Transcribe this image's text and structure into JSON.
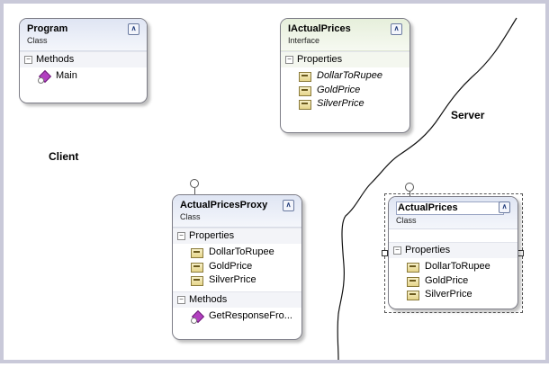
{
  "labels": {
    "client": "Client",
    "server": "Server"
  },
  "shapes": {
    "program": {
      "name": "Program",
      "kind": "Class",
      "sections": [
        {
          "title": "Methods",
          "members": [
            {
              "name": "Main",
              "icon": "method-icon"
            }
          ]
        }
      ]
    },
    "iactualprices": {
      "name": "IActualPrices",
      "kind": "Interface",
      "sections": [
        {
          "title": "Properties",
          "members": [
            {
              "name": "DollarToRupee",
              "icon": "property-icon"
            },
            {
              "name": "GoldPrice",
              "icon": "property-icon"
            },
            {
              "name": "SilverPrice",
              "icon": "property-icon"
            }
          ]
        }
      ]
    },
    "proxy": {
      "name": "ActualPricesProxy",
      "kind": "Class",
      "sections": [
        {
          "title": "Properties",
          "members": [
            {
              "name": "DollarToRupee",
              "icon": "property-icon"
            },
            {
              "name": "GoldPrice",
              "icon": "property-icon"
            },
            {
              "name": "SilverPrice",
              "icon": "property-icon"
            }
          ]
        },
        {
          "title": "Methods",
          "members": [
            {
              "name": "GetResponseFro...",
              "icon": "method-icon"
            }
          ]
        }
      ]
    },
    "actualprices": {
      "name": "ActualPrices",
      "kind": "Class",
      "sections": [
        {
          "title": "Properties",
          "members": [
            {
              "name": "DollarToRupee",
              "icon": "property-icon"
            },
            {
              "name": "GoldPrice",
              "icon": "property-icon"
            },
            {
              "name": "SilverPrice",
              "icon": "property-icon"
            }
          ]
        }
      ]
    }
  },
  "colors": {
    "canvas_border": "#c9c9d9",
    "class_header": "#dfe5f3",
    "interface_header": "#e6efdb",
    "method_icon": "#b23fc0"
  }
}
